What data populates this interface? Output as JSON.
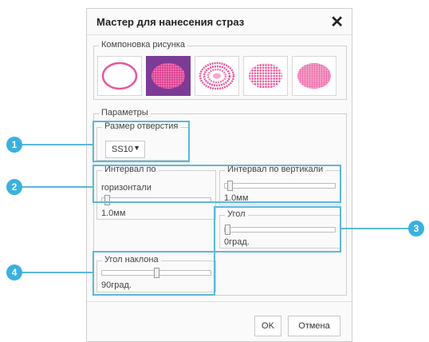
{
  "dialog": {
    "title": "Мастер для нанесения страз",
    "close_icon": "close-icon"
  },
  "layout_group": {
    "legend": "Компоновка рисунка",
    "tiles": [
      {
        "pattern": "outline-ellipse",
        "selected": false
      },
      {
        "pattern": "filled-grid-ellipse",
        "selected": true
      },
      {
        "pattern": "concentric-dots-ellipse",
        "selected": false
      },
      {
        "pattern": "ring-rows-ellipse",
        "selected": false
      },
      {
        "pattern": "dense-rows-ellipse",
        "selected": false
      }
    ]
  },
  "params": {
    "legend": "Параметры",
    "hole_size": {
      "legend": "Размер отверстия",
      "value": "SS10"
    },
    "h_interval": {
      "label_line1": "Интервал по",
      "label_line2": "горизонтали",
      "value": "1.0мм",
      "level": 0.02
    },
    "v_interval": {
      "label": "Интервал по вертикали",
      "value": "1.0мм",
      "level": 0.02
    },
    "angle": {
      "label": "Угол",
      "value": "0град.",
      "level": 0.0
    },
    "tilt": {
      "label": "Угол наклона",
      "value": "90град.",
      "level": 0.5
    }
  },
  "buttons": {
    "ok": "OK",
    "cancel": "Отмена"
  },
  "callouts": [
    "1",
    "2",
    "3",
    "4"
  ],
  "colors": {
    "accent": "#5bb8dc",
    "callout": "#3ab1dd",
    "selected_tile": "#7b3b96",
    "rhinestone_pink": "#e8559a"
  }
}
